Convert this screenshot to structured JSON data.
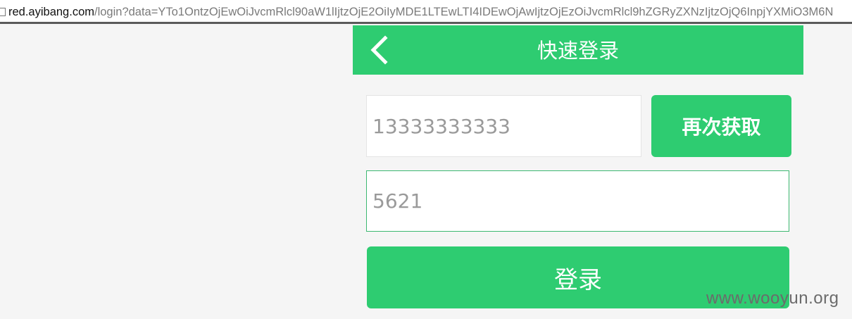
{
  "browser": {
    "url_host": "red.ayibang.com",
    "url_rest": "/login?data=YTo1OntzOjEwOiJvcmRlcl90aW1lIjtzOjE2OiIyMDE1LTEwLTI4IDEwOjAwIjtzOjEzOiJvcmRlcl9hZGRyZXNzIjtzOjQ6InpjYXMiO3M6N",
    "page_icon": "page-icon"
  },
  "header": {
    "back_icon": "chevron-left-icon",
    "title": "快速登录",
    "color": "#2ecc71"
  },
  "form": {
    "phone_value": "13333333333",
    "resend_label": "再次获取",
    "code_value": "5621",
    "login_label": "登录"
  },
  "watermark": {
    "text": "www.wooyun.org"
  }
}
